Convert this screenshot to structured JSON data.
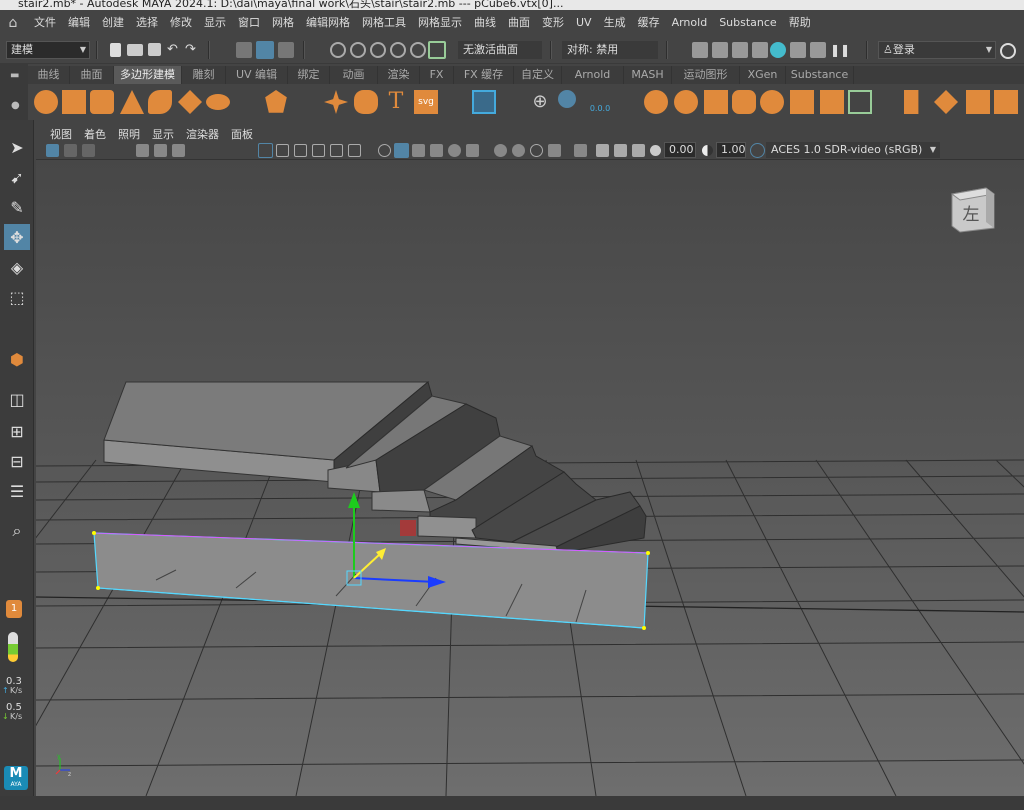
{
  "window": {
    "title": "stair2.mb* - Autodesk MAYA 2024.1: D:\\dai\\maya\\final work\\石头\\stair\\stair2.mb  ---  pCube6.vtx[0]..."
  },
  "menubar": {
    "items": [
      "文件",
      "编辑",
      "创建",
      "选择",
      "修改",
      "显示",
      "窗口",
      "网格",
      "编辑网格",
      "网格工具",
      "网格显示",
      "曲线",
      "曲面",
      "变形",
      "UV",
      "生成",
      "缓存",
      "Arnold",
      "Substance",
      "帮助"
    ]
  },
  "statusline": {
    "mode": "建模",
    "live_surface": "无激活曲面",
    "symmetry": "对称: 禁用",
    "login": "登录"
  },
  "shelf": {
    "tabs": [
      "曲线",
      "曲面",
      "多边形建模",
      "雕刻",
      "UV 编辑",
      "绑定",
      "动画",
      "渲染",
      "FX",
      "FX 缓存",
      "自定义",
      "Arnold",
      "MASH",
      "运动图形",
      "XGen",
      "Substance"
    ],
    "active_tab": "多边形建模",
    "svg_label": "svg",
    "bonus_label": "0.0.0"
  },
  "viewport_menu": {
    "items": [
      "视图",
      "着色",
      "照明",
      "显示",
      "渲染器",
      "面板"
    ]
  },
  "viewport_toolbar": {
    "exposure": "0.00",
    "gamma": "1.00",
    "color_space": "ACES 1.0 SDR-video (sRGB)"
  },
  "viewcube": {
    "label": "左"
  },
  "toolbox": {
    "badge": "1",
    "net_up": "0.3",
    "net_up_unit": "K/s",
    "net_down": "0.5",
    "net_down_unit": "K/s",
    "maya_logo": "M",
    "maya_logo_sub": "AYA"
  },
  "axes": {
    "y": "y",
    "x": "x",
    "z": "z"
  },
  "colors": {
    "accent": "#5285a6",
    "selection": "#55d8ff",
    "move_x": "#1a3cff",
    "move_y": "#1dcc1d",
    "move_z": "#ffee33"
  }
}
